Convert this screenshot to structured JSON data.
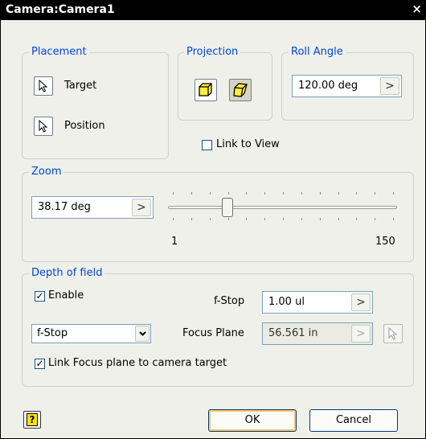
{
  "window": {
    "title": "Camera:Camera1",
    "close_glyph": "×"
  },
  "placement": {
    "legend": "Placement",
    "target_label": "Target",
    "position_label": "Position",
    "target_icon": "cursor-arrow-icon",
    "position_icon": "cursor-arrow-icon"
  },
  "projection": {
    "legend": "Projection",
    "orthographic_icon": "orthographic-cube-icon",
    "perspective_icon": "perspective-cube-icon",
    "active": "perspective"
  },
  "roll_angle": {
    "legend": "Roll Angle",
    "value": "120.00 deg",
    "arrow": ">"
  },
  "link_to_view": {
    "label": "Link to View",
    "checked": false
  },
  "zoom": {
    "legend": "Zoom",
    "value": "38.17 deg",
    "arrow": ">",
    "slider_min": "1",
    "slider_max": "150",
    "slider_value": 38.17
  },
  "depth_of_field": {
    "legend": "Depth of field",
    "enable_label": "Enable",
    "enable_checked": true,
    "mode_value": "f-Stop",
    "fstop_label": "f-Stop",
    "fstop_value": "1.00 ul",
    "fstop_arrow": ">",
    "focus_plane_label": "Focus Plane",
    "focus_plane_value": "56.561 in",
    "focus_plane_arrow": ">",
    "link_focus_label": "Link Focus plane to camera target",
    "link_focus_checked": true,
    "check_glyph": "✓"
  },
  "footer": {
    "help_glyph": "?",
    "ok_label": "OK",
    "cancel_label": "Cancel"
  },
  "colors": {
    "accent": "#0046d5",
    "titlebar": "#000000",
    "dialog_bg": "#f0f0ea"
  }
}
